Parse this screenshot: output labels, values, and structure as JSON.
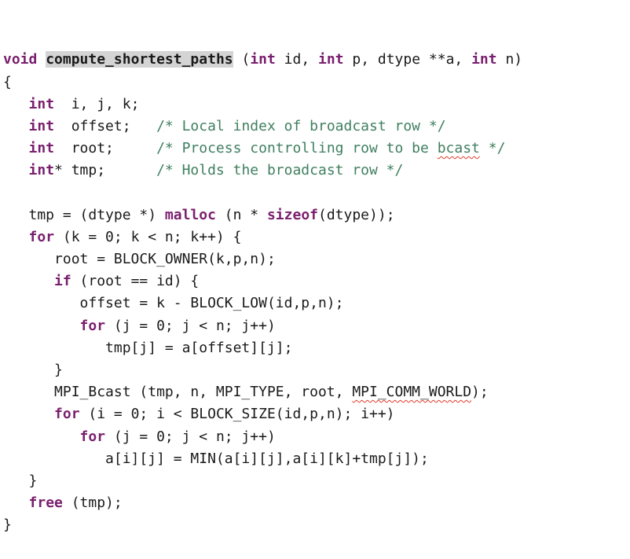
{
  "editor": {
    "lines": [
      [
        {
          "t": "void",
          "s": "kw"
        },
        {
          "t": " ",
          "s": ""
        },
        {
          "t": "compute_shortest_paths",
          "s": "fnhl"
        },
        {
          "t": " (",
          "s": ""
        },
        {
          "t": "int",
          "s": "kw"
        },
        {
          "t": " id, ",
          "s": ""
        },
        {
          "t": "int",
          "s": "kw"
        },
        {
          "t": " p, dtype **a, ",
          "s": ""
        },
        {
          "t": "int",
          "s": "kw"
        },
        {
          "t": " n)",
          "s": ""
        }
      ],
      [
        {
          "t": "{",
          "s": ""
        }
      ],
      [
        {
          "t": "   ",
          "s": ""
        },
        {
          "t": "int",
          "s": "kw"
        },
        {
          "t": "  i, j, k;",
          "s": ""
        }
      ],
      [
        {
          "t": "   ",
          "s": ""
        },
        {
          "t": "int",
          "s": "kw"
        },
        {
          "t": "  offset;   ",
          "s": ""
        },
        {
          "t": "/* Local index of broadcast row */",
          "s": "cm"
        }
      ],
      [
        {
          "t": "   ",
          "s": ""
        },
        {
          "t": "int",
          "s": "kw"
        },
        {
          "t": "  root;     ",
          "s": ""
        },
        {
          "t": "/* Process controlling row to be ",
          "s": "cm"
        },
        {
          "t": "bcast",
          "s": "cm spell"
        },
        {
          "t": " */",
          "s": "cm"
        }
      ],
      [
        {
          "t": "   ",
          "s": ""
        },
        {
          "t": "int",
          "s": "kw"
        },
        {
          "t": "* tmp;      ",
          "s": ""
        },
        {
          "t": "/* Holds the broadcast row */",
          "s": "cm"
        }
      ],
      [
        {
          "t": "",
          "s": ""
        }
      ],
      [
        {
          "t": "   tmp = (dtype *) ",
          "s": ""
        },
        {
          "t": "malloc",
          "s": "kw"
        },
        {
          "t": " (n * ",
          "s": ""
        },
        {
          "t": "sizeof",
          "s": "kw"
        },
        {
          "t": "(dtype));",
          "s": ""
        }
      ],
      [
        {
          "t": "   ",
          "s": ""
        },
        {
          "t": "for",
          "s": "kw"
        },
        {
          "t": " (k = 0; k < n; k++) {",
          "s": ""
        }
      ],
      [
        {
          "t": "      root = BLOCK_OWNER(k,p,n);",
          "s": ""
        }
      ],
      [
        {
          "t": "      ",
          "s": ""
        },
        {
          "t": "if",
          "s": "kw"
        },
        {
          "t": " (root == id) {",
          "s": ""
        }
      ],
      [
        {
          "t": "         offset = k - BLOCK_LOW(id,p,n);",
          "s": ""
        }
      ],
      [
        {
          "t": "         ",
          "s": ""
        },
        {
          "t": "for",
          "s": "kw"
        },
        {
          "t": " (j = 0; j < n; j++)",
          "s": ""
        }
      ],
      [
        {
          "t": "            tmp[j] = a[offset][j];",
          "s": ""
        }
      ],
      [
        {
          "t": "      }",
          "s": ""
        }
      ],
      [
        {
          "t": "      MPI_Bcast (tmp, n, MPI_TYPE, root, ",
          "s": ""
        },
        {
          "t": "MPI_COMM_WORLD",
          "s": "spell"
        },
        {
          "t": ");",
          "s": ""
        }
      ],
      [
        {
          "t": "      ",
          "s": ""
        },
        {
          "t": "for",
          "s": "kw"
        },
        {
          "t": " (i = 0; i < BLOCK_SIZE(id,p,n); i++)",
          "s": ""
        }
      ],
      [
        {
          "t": "         ",
          "s": ""
        },
        {
          "t": "for",
          "s": "kw"
        },
        {
          "t": " (j = 0; j < n; j++)",
          "s": ""
        }
      ],
      [
        {
          "t": "            a[i][j] = MIN(a[i][j],a[i][k]+tmp[j]);",
          "s": ""
        }
      ],
      [
        {
          "t": "   }",
          "s": ""
        }
      ],
      [
        {
          "t": "   ",
          "s": ""
        },
        {
          "t": "free",
          "s": "kw"
        },
        {
          "t": " (tmp);",
          "s": ""
        }
      ],
      [
        {
          "t": "}",
          "s": ""
        }
      ]
    ]
  }
}
